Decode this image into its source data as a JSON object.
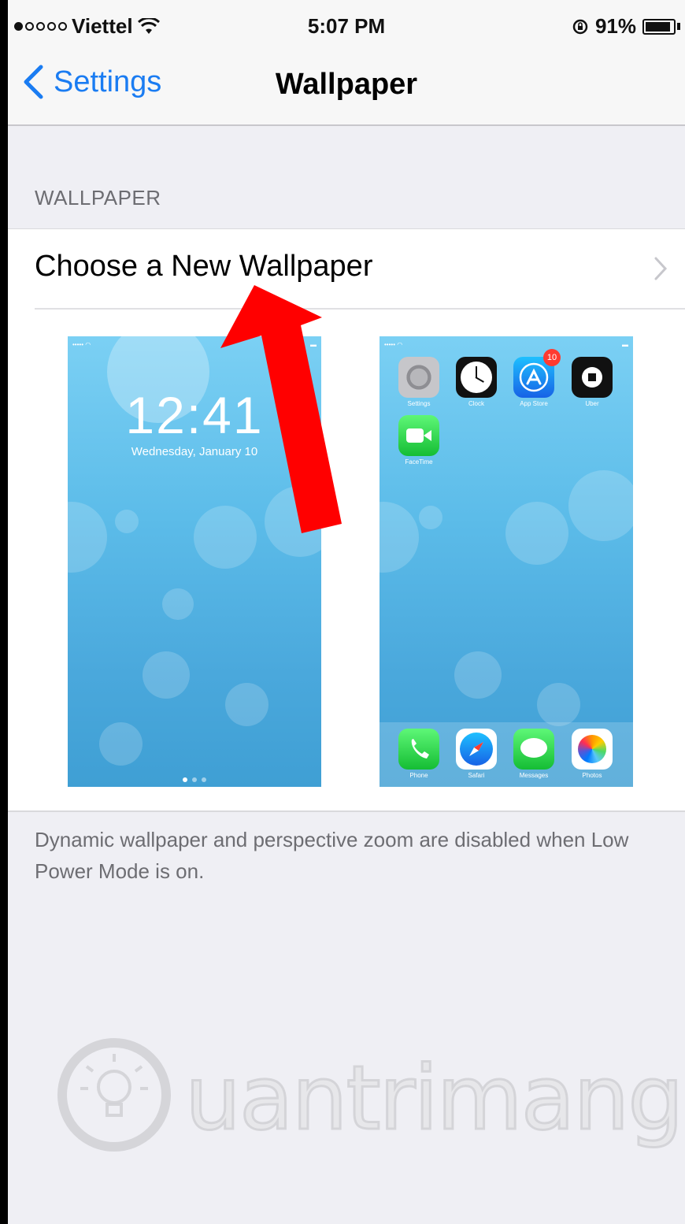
{
  "status_bar": {
    "carrier": "Viettel",
    "time": "5:07 PM",
    "battery": "91%",
    "battery_level": 0.91
  },
  "nav": {
    "back_label": "Settings",
    "title": "Wallpaper"
  },
  "section": {
    "header": "WALLPAPER",
    "row_label": "Choose a New Wallpaper"
  },
  "lock_preview": {
    "time": "12:41",
    "date": "Wednesday, January 10"
  },
  "home_preview": {
    "apps": [
      "Settings",
      "Clock",
      "App Store",
      "Uber",
      "FaceTime"
    ],
    "dock": [
      "Phone",
      "Safari",
      "Messages",
      "Photos"
    ],
    "badge": "10"
  },
  "footer": {
    "note": "Dynamic wallpaper and perspective zoom are disabled when Low Power Mode is on."
  },
  "watermark": "Quantrimang",
  "colors": {
    "accent": "#1a7cf2",
    "arrow": "#ff0000",
    "background": "#efeff4"
  }
}
